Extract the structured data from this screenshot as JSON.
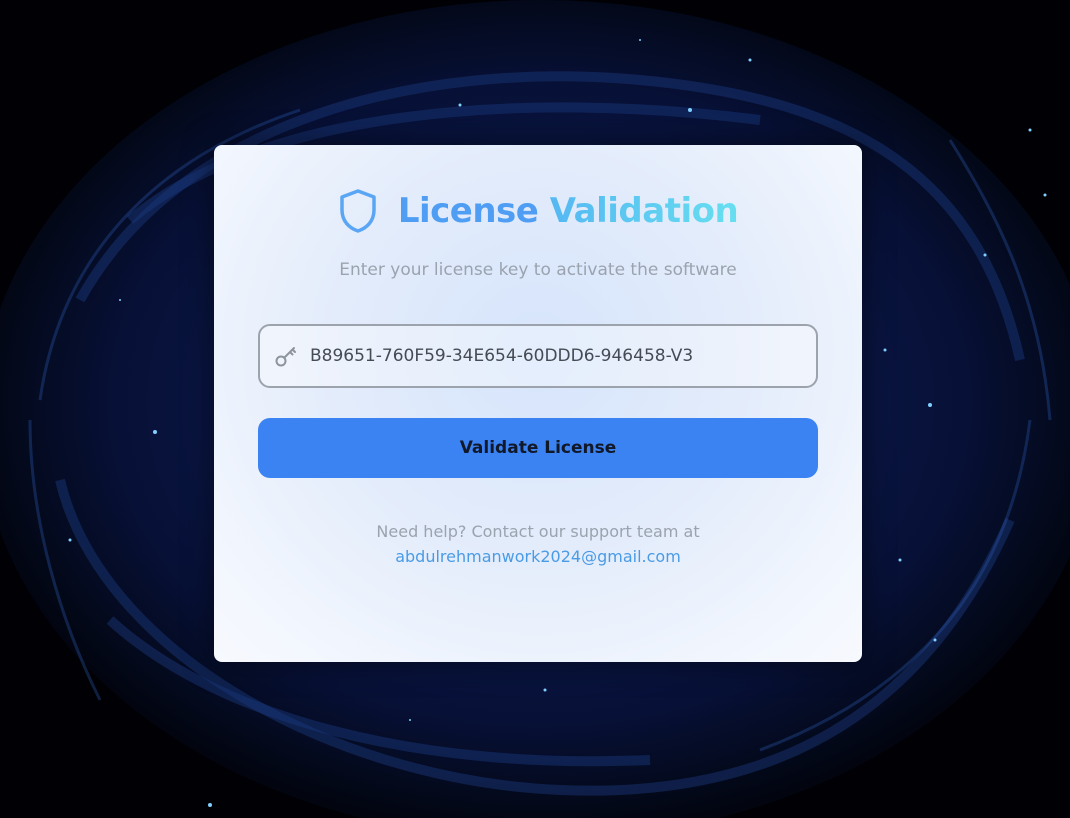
{
  "colors": {
    "accent": "#3b82f3",
    "title_primary": "#4f9ef3",
    "title_secondary": "#5ed0f0",
    "link": "#4a9be6",
    "muted_text": "#9aa3ae"
  },
  "card": {
    "icon": "shield-icon",
    "title_part1": "License",
    "title_part2": "Validation",
    "subtitle": "Enter your license key to activate the software"
  },
  "license_field": {
    "icon": "key-icon",
    "value": "B89651-760F59-34E654-60DDD6-946458-V3",
    "placeholder": ""
  },
  "validate_button": {
    "label": "Validate License"
  },
  "help": {
    "text": "Need help? Contact our support team at",
    "email": "abdulrehmanwork2024@gmail.com"
  }
}
